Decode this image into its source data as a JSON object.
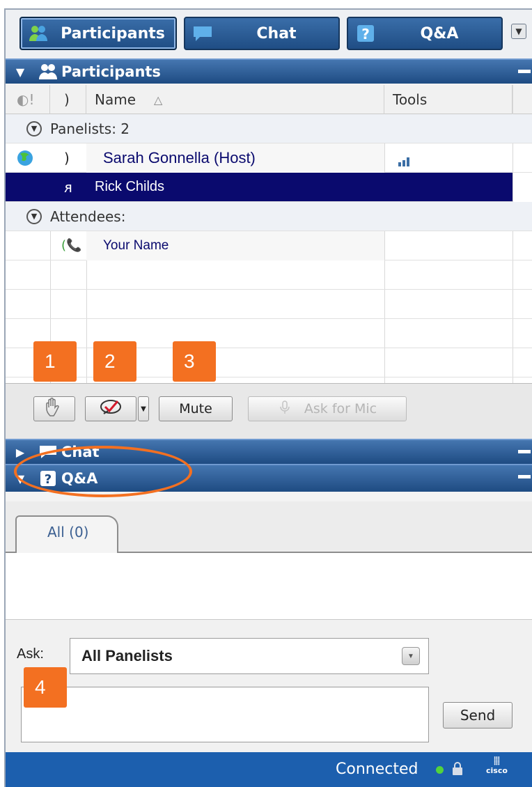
{
  "topbar": {
    "tabs": [
      {
        "label": "Participants",
        "icon": "participants-icon"
      },
      {
        "label": "Chat",
        "icon": "chat-bubble-icon"
      },
      {
        "label": "Q&A",
        "icon": "question-icon"
      }
    ],
    "menu_icon": "dropdown-menu-icon"
  },
  "participants_section": {
    "title": "Participants",
    "columns": {
      "status": "◐!",
      "phone": ")",
      "name": "Name",
      "sort_indicator": "△",
      "tools": "Tools"
    },
    "groups": {
      "panelists": "Panelists: 2",
      "attendees": "Attendees:"
    },
    "rows": [
      {
        "name": "Sarah Gonnella (Host)",
        "role": "host"
      },
      {
        "name": "Rick Childs",
        "selected": true
      },
      {
        "name": "Your Name"
      }
    ]
  },
  "toolbar": {
    "raise_hand": "raise-hand-icon",
    "feedback": "feedback-check-icon",
    "mute_label": "Mute",
    "ask_for_mic_label": "Ask for Mic"
  },
  "badges": [
    "1",
    "2",
    "3",
    "4"
  ],
  "chat_section": {
    "title": "Chat"
  },
  "qa_section": {
    "title": "Q&A",
    "tab_label": "All (0)",
    "ask_label": "Ask:",
    "ask_value": "All Panelists",
    "send_label": "Send"
  },
  "status": {
    "text": "Connected",
    "brand": "cisco",
    "accent": "#f37021",
    "header_color": "#1e4b82"
  }
}
